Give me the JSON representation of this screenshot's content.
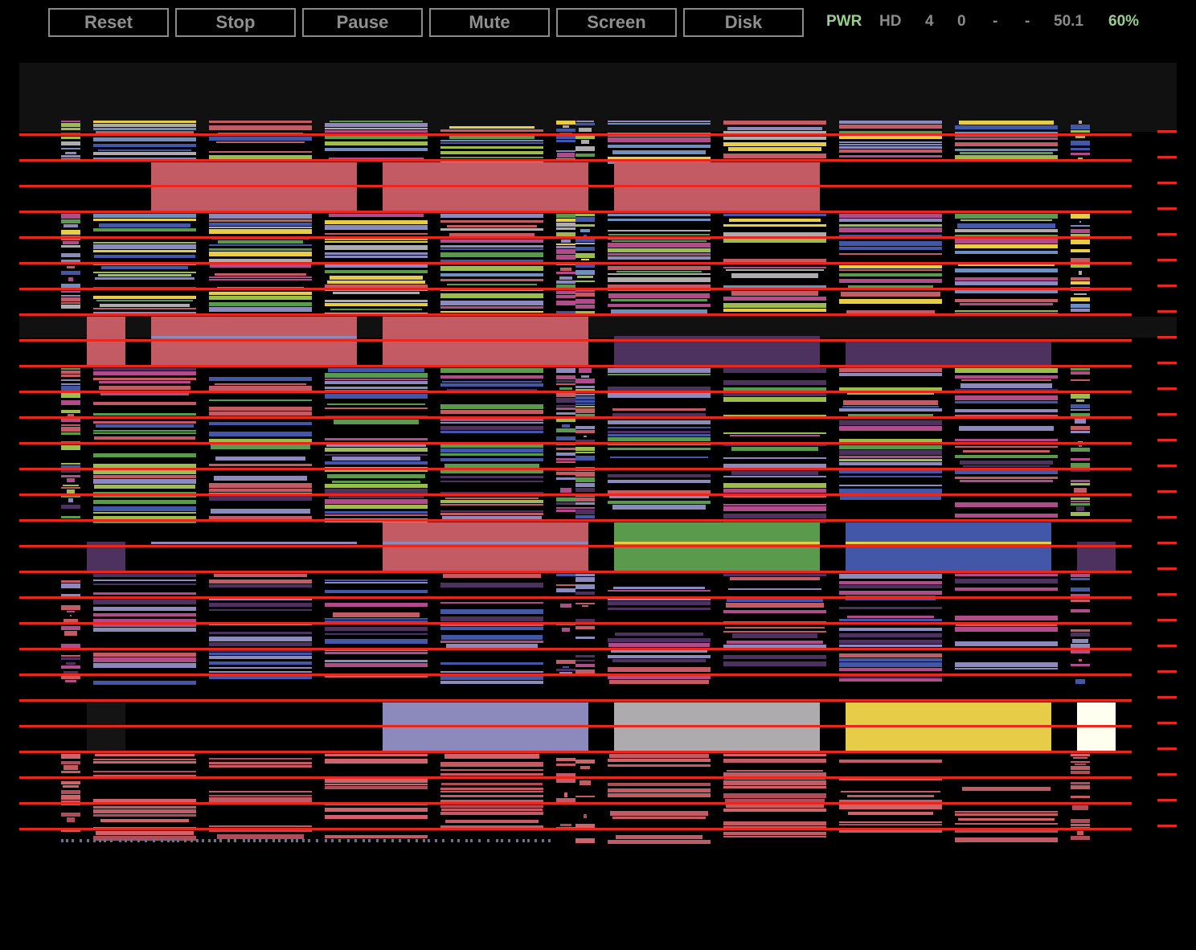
{
  "toolbar": {
    "buttons": [
      {
        "label": "Reset"
      },
      {
        "label": "Stop"
      },
      {
        "label": "Pause"
      },
      {
        "label": "Mute"
      },
      {
        "label": "Screen"
      },
      {
        "label": "Disk"
      }
    ]
  },
  "status": {
    "power": "PWR",
    "drive": "HD",
    "track": "4",
    "sector": "0",
    "field_a": "-",
    "field_b": "-",
    "rate": "50.1",
    "speed": "60%"
  },
  "colors": {
    "background": "#000000",
    "button_border": "#8a8a8a",
    "button_text": "#8f8f8f",
    "status_text": "#8a8a8a",
    "status_ok": "#9acd8e",
    "scanline_red": "#e8281e",
    "block_salmon": "#c25b63",
    "block_purple": "#4d315e",
    "block_green": "#5a9a4c",
    "block_blue": "#4357a8",
    "block_lavender": "#8c8abc",
    "block_gray": "#adabae",
    "block_yellow": "#e6cc47",
    "block_cream": "#fffff0",
    "block_black": "#141414"
  },
  "display": {
    "description_icon": "emulator-screen-icon"
  }
}
